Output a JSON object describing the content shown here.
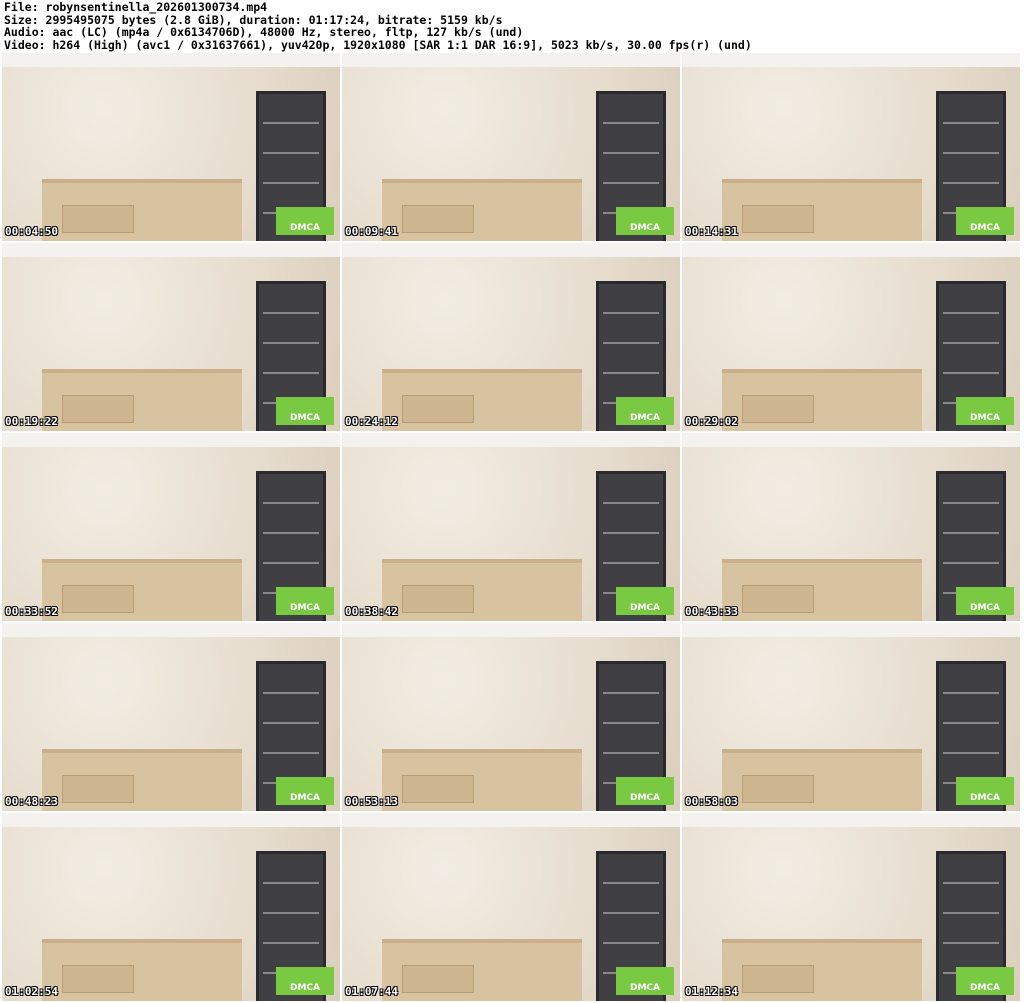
{
  "header": {
    "file": "File: robynsentinella_202601300734.mp4",
    "size": "Size: 2995495075 bytes (2.8 GiB), duration: 01:17:24, bitrate: 5159 kb/s",
    "audio": "Audio: aac (LC) (mp4a / 0x6134706D), 48000 Hz, stereo, fltp, 127 kb/s (und)",
    "video": "Video: h264 (High) (avc1 / 0x31637661), yuv420p, 1920x1080 [SAR 1:1 DAR 16:9], 5023 kb/s, 30.00 fps(r) (und)"
  },
  "watermark": "DMCA",
  "thumbnails": [
    {
      "timestamp": "00:04:50"
    },
    {
      "timestamp": "00:09:41"
    },
    {
      "timestamp": "00:14:31"
    },
    {
      "timestamp": "00:19:22"
    },
    {
      "timestamp": "00:24:12"
    },
    {
      "timestamp": "00:29:02"
    },
    {
      "timestamp": "00:33:52"
    },
    {
      "timestamp": "00:38:42"
    },
    {
      "timestamp": "00:43:33"
    },
    {
      "timestamp": "00:48:23"
    },
    {
      "timestamp": "00:53:13"
    },
    {
      "timestamp": "00:58:03"
    },
    {
      "timestamp": "01:02:54"
    },
    {
      "timestamp": "01:07:44"
    },
    {
      "timestamp": "01:12:34"
    }
  ]
}
